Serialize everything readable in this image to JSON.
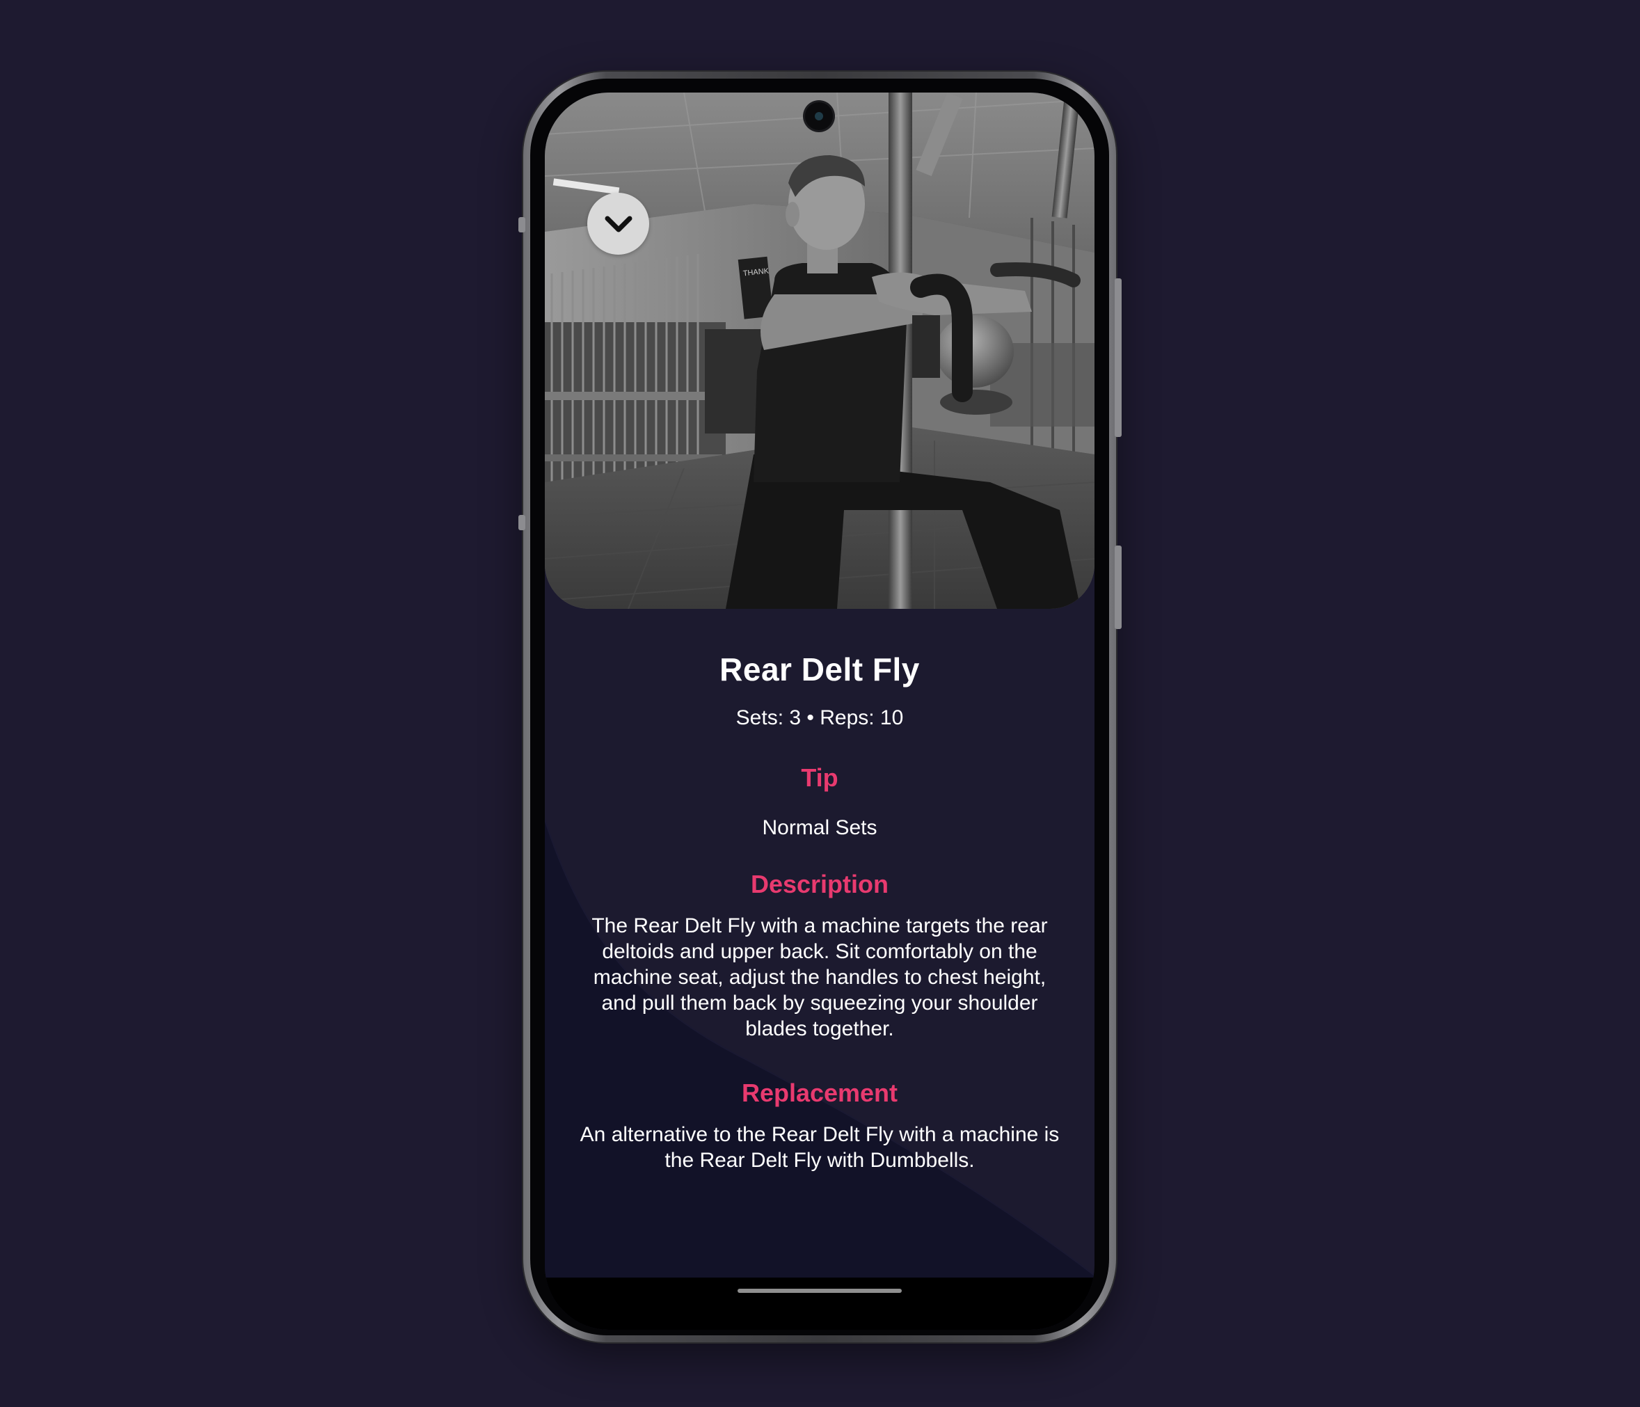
{
  "exercise": {
    "title": "Rear Delt Fly",
    "sets_reps": "Sets: 3 • Reps: 10"
  },
  "tip": {
    "heading": "Tip",
    "text": "Normal Sets"
  },
  "description": {
    "heading": "Description",
    "text": "The Rear Delt Fly with a machine targets the rear deltoids and upper back. Sit comfortably on the machine seat, adjust the handles to chest height, and pull them back by squeezing your shoulder blades together."
  },
  "replacement": {
    "heading": "Replacement",
    "text": "An alternative to the Rear Delt Fly with a machine is the Rear Delt Fly with Dumbbells."
  },
  "photo": {
    "subject": "man performing rear delt fly on machine, grayscale gym photo",
    "poster_text": "THANK"
  },
  "icons": {
    "collapse": "chevron-down-icon"
  },
  "colors": {
    "page_background": "#1e1a30",
    "screen_background": "#1c1a2f",
    "accent": "#e83a6f",
    "text": "#ffffff"
  }
}
